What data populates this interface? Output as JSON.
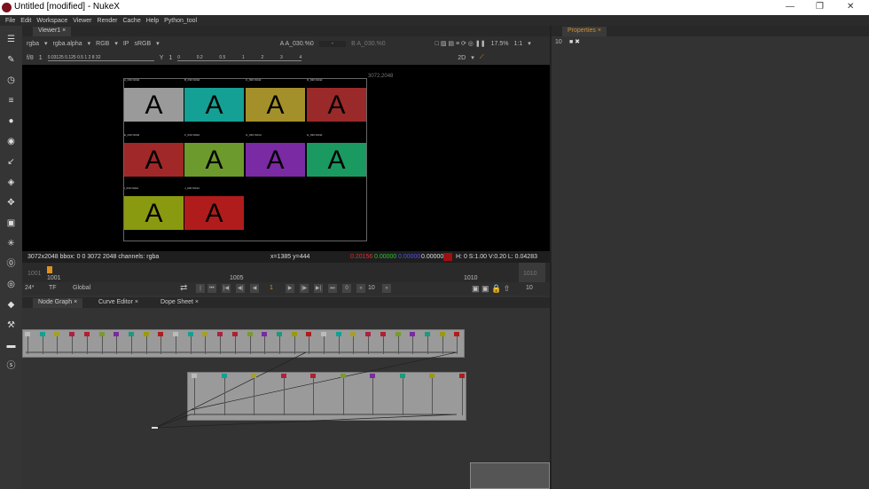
{
  "window": {
    "title": "Untitled [modified] - NukeX",
    "minimize": "—",
    "maximize": "❐",
    "close": "✕"
  },
  "menu": [
    "File",
    "Edit",
    "Workspace",
    "Viewer",
    "Render",
    "Cache",
    "Help",
    "Python_tool"
  ],
  "viewer_tab": "Viewer1",
  "viewer_toolbar": {
    "channels": "rgba",
    "alpha": "rgba.alpha",
    "display": "RGB",
    "ip": "IP",
    "lut": "sRGB",
    "a_input": "A  A_030.%0",
    "a_op": "-",
    "b_input": "B  A_030.%0",
    "zoom": "17.5%",
    "ratio": "1:1"
  },
  "viewer_toolbar2": {
    "fstop": "f/8",
    "frame_step": "1",
    "gain_ticks": "0.03125 0.125 0.5 1 2 8 32",
    "gamma_label": "Y",
    "gamma_value": "1",
    "gamma_ticks": [
      "0",
      "0.2",
      "0.5",
      "1",
      "2",
      "3",
      "4"
    ],
    "view_mode": "2D"
  },
  "image": {
    "format_corner": "3072,2048",
    "tiles": [
      {
        "label": "A_030.%04d",
        "letter": "A",
        "color": "#9a9a9a"
      },
      {
        "label": "B_030.%04d",
        "letter": "A",
        "color": "#14a094"
      },
      {
        "label": "C_030.%04d",
        "letter": "A",
        "color": "#a4902a"
      },
      {
        "label": "D_030.%04d",
        "letter": "A",
        "color": "#9a2a2a"
      },
      {
        "label": "E_030.%04d",
        "letter": "A",
        "color": "#a02828"
      },
      {
        "label": "F_030.%04d",
        "letter": "A",
        "color": "#6c9a2c"
      },
      {
        "label": "G_030.%04d",
        "letter": "A",
        "color": "#7a2aa2"
      },
      {
        "label": "H_030.%04d",
        "letter": "A",
        "color": "#1a9a60"
      },
      {
        "label": "I_030.%04d",
        "letter": "A",
        "color": "#8a9a10"
      },
      {
        "label": "J_030.%04d",
        "letter": "A",
        "color": "#b01c1c"
      }
    ]
  },
  "info": {
    "format": "3072x2048  bbox: 0 0 3072 2048 channels: rgba",
    "coords": "x=1385 y=444",
    "r": "0.20156",
    "g": "0.00000",
    "b": "0.00000",
    "a": "0.00000",
    "hsv": "H:  0 S:1.00 V:0.20  L: 0.04283"
  },
  "timeline": {
    "start": "1001",
    "end": "1010",
    "current": "1001",
    "mid": "1005",
    "end_label": "1010"
  },
  "playback": {
    "fps": "24*",
    "tf": "TF",
    "scope": "Global",
    "frame": "1",
    "skip": "10",
    "end_frame": "10"
  },
  "bottom_tabs": [
    "Node Graph",
    "Curve Editor",
    "Dope Sheet"
  ],
  "properties": {
    "tab": "Properties",
    "max_panels": "10"
  }
}
